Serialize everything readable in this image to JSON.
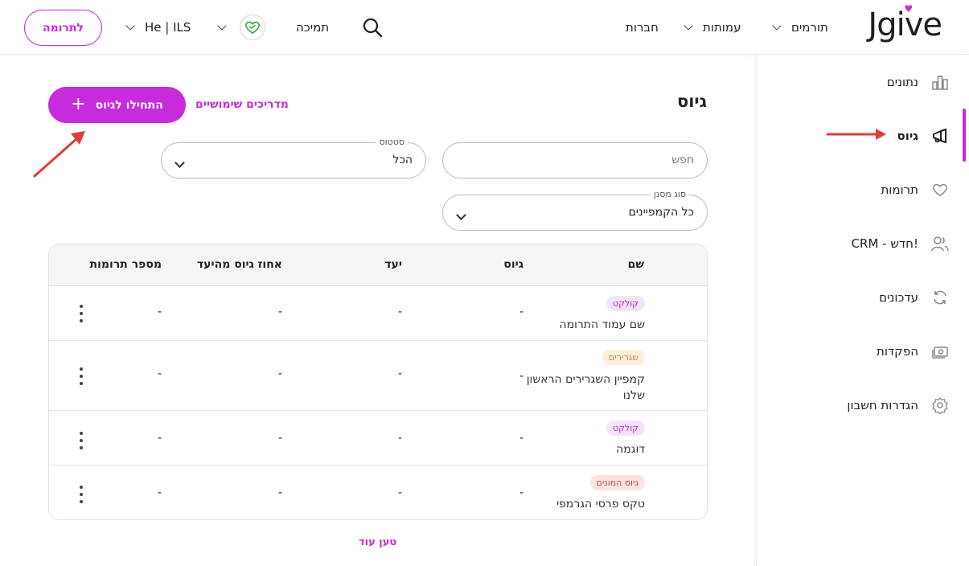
{
  "header": {
    "donate_label": "לתרומה",
    "currency_label": "He | ILS",
    "support_label": "תמיכה",
    "nav": [
      {
        "label": "תורמים"
      },
      {
        "label": "עמותות"
      },
      {
        "label": "חברות"
      }
    ],
    "logo_text": "Jgive"
  },
  "sidebar": {
    "items": [
      {
        "label": "נתונים",
        "icon": "bar-chart-icon"
      },
      {
        "label": "גיוס",
        "icon": "megaphone-icon",
        "active": true
      },
      {
        "label": "תרומות",
        "icon": "heart-icon"
      },
      {
        "label": "CRM - חדש!",
        "icon": "users-icon"
      },
      {
        "label": "עדכונים",
        "icon": "refresh-icon"
      },
      {
        "label": "הפקדות",
        "icon": "cash-icon"
      },
      {
        "label": "הגדרות חשבון",
        "icon": "gear-icon"
      }
    ],
    "accent_color": "#c62bdc"
  },
  "main": {
    "title": "גיוס",
    "start_button_label": "התחילו לגיוס",
    "guides_link": "מדריכים שימושיים",
    "search": {
      "placeholder": "חפש"
    },
    "status_filter": {
      "legend": "סטטוס",
      "value": "הכל"
    },
    "type_filter": {
      "legend": "סוג מסנן",
      "value": "כל הקמפיינים"
    },
    "table": {
      "headers": {
        "name": "שם",
        "raised": "גיוס",
        "goal": "יעד",
        "percent": "אחוז גיוס מהיעד",
        "donations": "מספר תרומות"
      },
      "rows": [
        {
          "badge": "קולקט",
          "name": "שם עמוד התרומה",
          "raised": "-",
          "goal": "-",
          "percent": "-",
          "donations": "-"
        },
        {
          "badge": "שגרירים",
          "name": "קמפיין השגרירים הראשון שלנו",
          "raised": "-",
          "goal": "-",
          "percent": "-",
          "donations": "-"
        },
        {
          "badge": "קולקט",
          "name": "דוגמה",
          "raised": "-",
          "goal": "-",
          "percent": "-",
          "donations": "-"
        },
        {
          "badge": "גיוס המונים",
          "name": "טקס פרסי הגרמפי",
          "raised": "-",
          "goal": "-",
          "percent": "-",
          "donations": "-"
        }
      ]
    },
    "load_more": "טען עוד"
  }
}
